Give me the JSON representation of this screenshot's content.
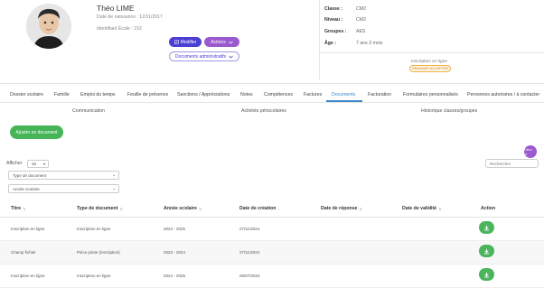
{
  "student": {
    "name": "Théo LIME",
    "dob": "Date de naissance : 12/11/2017",
    "school_id": "Identifiant École : 152"
  },
  "header_buttons": {
    "modifier": "Modifier",
    "actions": "Actions",
    "docs_admin": "Documents administratifs"
  },
  "info": [
    {
      "label": "Classe :",
      "value": "CM2"
    },
    {
      "label": "Niveau :",
      "value": "CM2"
    },
    {
      "label": "Groupes :",
      "value": "AES"
    },
    {
      "label": "Âge :",
      "value": "7 ans 3 mois"
    }
  ],
  "request": {
    "label": "Inscription en ligne",
    "status": "DEMANDE ACCEPTÉE"
  },
  "tabs": [
    "Dossier scolaire",
    "Famille",
    "Emploi du temps",
    "Feuille de présence",
    "Sanctions / Appréciations",
    "Notes",
    "Compétences",
    "Factures",
    "Documents",
    "Facturation",
    "Formulaires personnalisés",
    "Personnes autorisées / à contacter"
  ],
  "active_tab": "Documents",
  "subtabs": [
    "Communication",
    "Activités périscolaires",
    "Historique classes/groupes"
  ],
  "toolbar": {
    "add_document": "Ajouter un document",
    "fab_label": "Dém. cl.",
    "show_label": "Afficher",
    "show_value": "10",
    "type_placeholder": "Type de document",
    "year_placeholder": "Année scolaire",
    "search_placeholder": "Rechercher"
  },
  "table": {
    "columns": [
      "Titre",
      "Type de document",
      "Année scolaire",
      "Date de création",
      "Date de réponse",
      "Date de validité",
      "Action"
    ],
    "rows": [
      {
        "title": "Inscription en ligne",
        "type": "Inscription en ligne",
        "year": "2024 - 2025",
        "created": "27/11/2024",
        "response": "",
        "validity": ""
      },
      {
        "title": "Champ fichier",
        "type": "Pièce jointe (inscription)",
        "year": "2023 - 2024",
        "created": "27/11/2024",
        "response": "",
        "validity": ""
      },
      {
        "title": "Inscription en ligne",
        "type": "Inscription en ligne",
        "year": "2024 - 2025",
        "created": "06/07/2024",
        "response": "",
        "validity": ""
      }
    ]
  },
  "colors": {
    "primary": "#4a3ed4",
    "purple": "#9b59d0",
    "green": "#45b558",
    "tab_active": "#3f86c7",
    "badge": "#f0b24b"
  },
  "icons": [
    "edit-icon",
    "chevron-down-icon",
    "download-icon",
    "sort-icon"
  ]
}
